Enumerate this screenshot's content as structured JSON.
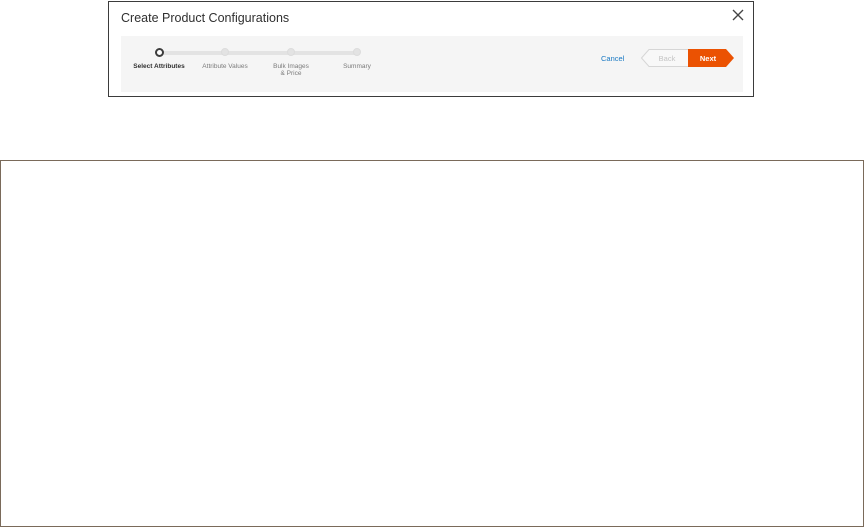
{
  "dialog": {
    "title": "Create Product Configurations"
  },
  "steps": [
    {
      "label": "Select Attributes",
      "active": true
    },
    {
      "label": "Attribute Values",
      "active": false
    },
    {
      "label": "Bulk Images & Price",
      "active": false
    },
    {
      "label": "Summary",
      "active": false
    }
  ],
  "actions": {
    "cancel_label": "Cancel",
    "back_label": "Back",
    "next_label": "Next"
  },
  "colors": {
    "accent": "#eb5202",
    "link": "#1979c3",
    "disabled": "#cfcfcf"
  },
  "icons": {
    "close": "close-icon"
  }
}
